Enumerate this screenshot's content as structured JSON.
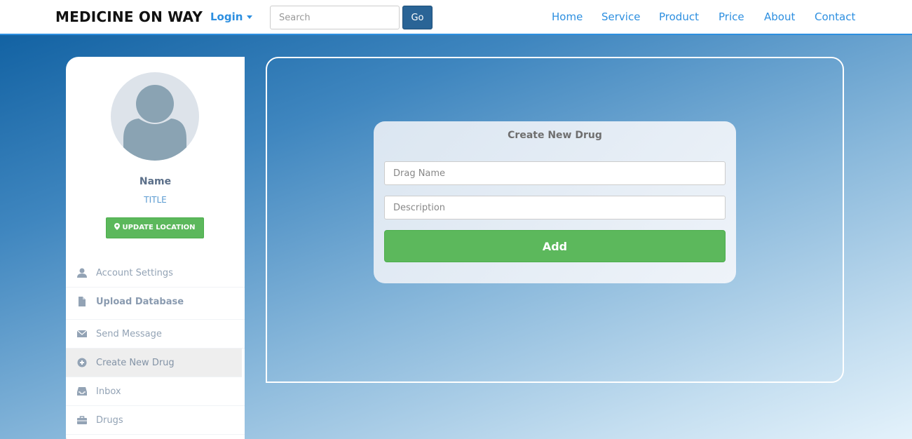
{
  "navbar": {
    "brand": "MEDICINE ON WAY",
    "login_label": "Login",
    "search": {
      "placeholder": "Search",
      "value": ""
    },
    "go_label": "Go",
    "links": [
      "Home",
      "Service",
      "Product",
      "Price",
      "About",
      "Contact"
    ]
  },
  "sidebar": {
    "profile_name": "Name",
    "profile_title": "TITLE",
    "update_location_label": "UPDATE LOCATION",
    "menu": [
      {
        "label": "Account Settings",
        "icon": "user-icon"
      },
      {
        "label": "Upload Database",
        "icon": "file-icon"
      },
      {
        "label": "Send Message",
        "icon": "envelope-icon"
      },
      {
        "label": "Create New Drug",
        "icon": "plus-circle-icon",
        "active": true
      },
      {
        "label": "Inbox",
        "icon": "inbox-icon"
      },
      {
        "label": "Drugs",
        "icon": "briefcase-icon"
      }
    ]
  },
  "form": {
    "title": "Create New Drug",
    "drug_name_placeholder": "Drag Name",
    "description_placeholder": "Description",
    "add_label": "Add"
  },
  "colors": {
    "accent": "#2d8fe0",
    "success": "#5cb85c",
    "go_button": "#2a6496"
  }
}
